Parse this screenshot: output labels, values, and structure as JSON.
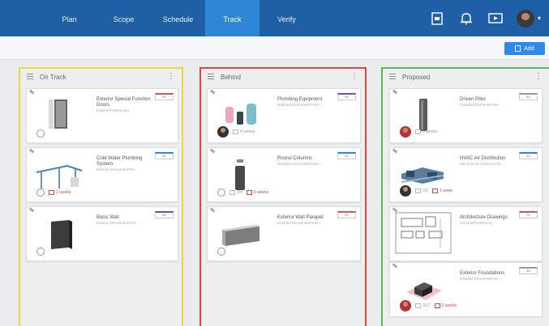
{
  "nav": {
    "tabs": [
      "Plan",
      "Scope",
      "Schedule",
      "Track",
      "Verify"
    ],
    "active_tab": "Track",
    "icons": [
      "document-icon",
      "bell-icon",
      "presentation-icon",
      "user-avatar"
    ]
  },
  "toolbar": {
    "add_button": "Add"
  },
  "columns": [
    {
      "title": "On Track",
      "color": "#f2d43c",
      "cards": [
        {
          "title": "Exterior Special Function Doors",
          "subtitle": "Exterior/Preliminary",
          "badge_color": "#d9534f",
          "badge": "3D",
          "meta": []
        },
        {
          "title": "Cold Water Plumbing System",
          "subtitle": "Exterior Elements/Preli...",
          "badge_color": "#2f86d6",
          "badge": "3D",
          "meta": [
            "2 weeks"
          ]
        },
        {
          "title": "Basic Wall",
          "subtitle": "Exterior Elements/Prelir...",
          "badge_color": "#7a4da0",
          "badge": "3D",
          "meta": []
        }
      ]
    },
    {
      "title": "Behind",
      "color": "#e0463f",
      "cards": [
        {
          "title": "Plumbing Equipment",
          "subtitle": "Detailed Elements/Prelim...",
          "badge_color": "#7a4da0",
          "badge": "3D",
          "meta": [
            "4 weeks"
          ]
        },
        {
          "title": "Round Columns",
          "subtitle": "Detailed Elements/Prelim...",
          "badge_color": "#2f86d6",
          "badge": "3D",
          "meta": [
            "3/4",
            "6 weeks"
          ]
        },
        {
          "title": "Exterior Wall Parapet",
          "subtitle": "Detailed Elements/Prelim...",
          "badge_color": "#d9534f",
          "badge": "3D",
          "meta": []
        }
      ]
    },
    {
      "title": "Proposed",
      "color": "#58b95a",
      "cards": [
        {
          "title": "Driven Piles",
          "subtitle": "Detailed Elements/Prel...",
          "badge_color": "#999999",
          "badge": "3D",
          "meta": [
            "6 weeks"
          ]
        },
        {
          "title": "HVAC Air Distribution",
          "subtitle": "Mechanical Components...",
          "badge_color": "#2f86d6",
          "badge": "3D",
          "meta": [
            "3/3",
            "1 week"
          ]
        },
        {
          "title": "Architecture Drawings",
          "subtitle": "General/Preliminary",
          "badge_color": "#d9534f",
          "badge": "2D",
          "meta": []
        },
        {
          "title": "Exterior Foundations",
          "subtitle": "Detailed Elements/Prel...",
          "badge_color": "#999999",
          "badge": "3D",
          "meta": [
            "3/27",
            "2 weeks"
          ]
        }
      ]
    }
  ]
}
